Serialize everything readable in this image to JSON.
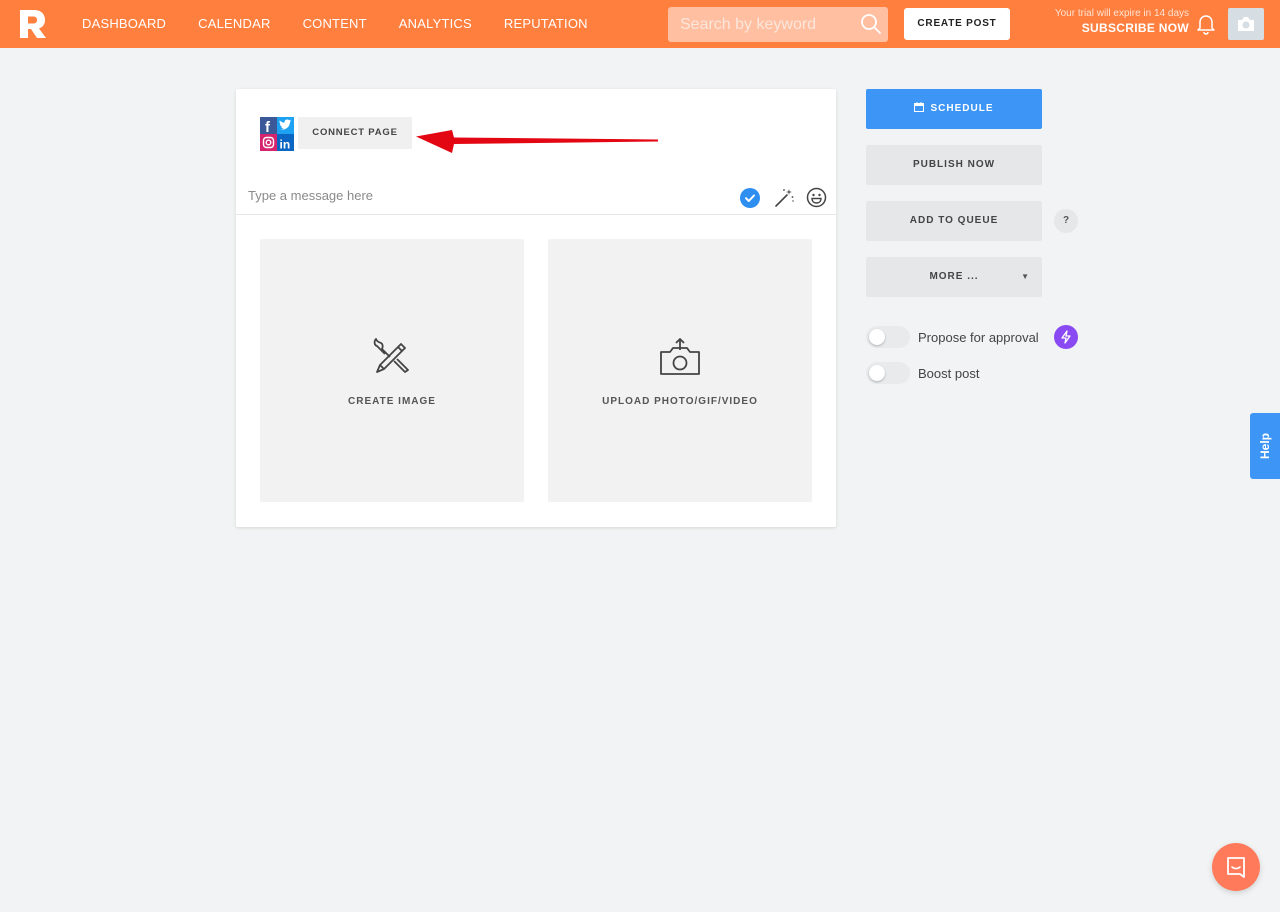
{
  "brand": {
    "logo_icon": "reputation-logo-icon",
    "accent_color": "#ff7f3f",
    "primary_color": "#3d95f5"
  },
  "nav": {
    "items": [
      {
        "label": "DASHBOARD"
      },
      {
        "label": "CALENDAR"
      },
      {
        "label": "CONTENT"
      },
      {
        "label": "ANALYTICS"
      },
      {
        "label": "REPUTATION"
      }
    ]
  },
  "search": {
    "placeholder": "Search by keyword",
    "value": "",
    "icon": "search-icon"
  },
  "header": {
    "create_post_label": "CREATE POST",
    "trial_note": "Your trial will expire in 14 days",
    "subscribe_label": "SUBSCRIBE NOW",
    "bell_icon": "bell-icon",
    "avatar_icon": "camera-icon"
  },
  "composer": {
    "connect_page_label": "CONNECT PAGE",
    "social_icons": [
      "facebook-icon",
      "twitter-icon",
      "instagram-icon",
      "linkedin-icon"
    ],
    "message_placeholder": "Type a message here",
    "message_value": "",
    "tools": [
      "check-icon",
      "magic-wand-icon",
      "emoji-icon"
    ],
    "tiles": [
      {
        "label": "CREATE IMAGE",
        "icon": "brush-pencil-icon"
      },
      {
        "label": "UPLOAD PHOTO/GIF/VIDEO",
        "icon": "camera-upload-icon"
      }
    ]
  },
  "actions": {
    "schedule_label": "SCHEDULE",
    "publish_now_label": "PUBLISH NOW",
    "add_to_queue_label": "ADD TO QUEUE",
    "queue_help": "?",
    "more_label": "MORE ...",
    "more_caret": "▼"
  },
  "options": {
    "propose_label": "Propose for approval",
    "propose_enabled": false,
    "boost_label": "Boost post",
    "boost_enabled": false
  },
  "help_tab_label": "Help"
}
